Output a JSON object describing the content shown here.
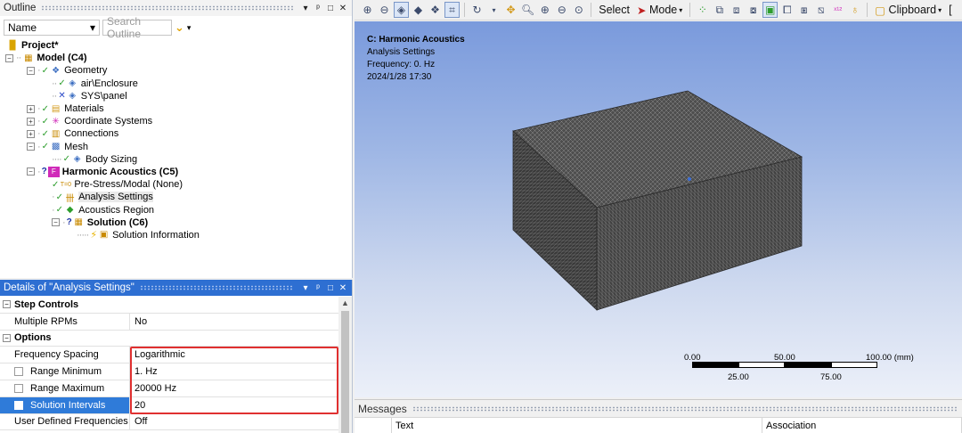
{
  "outline": {
    "title": "Outline",
    "controls": [
      "▾",
      "ᵖ",
      "□",
      "✕"
    ],
    "filter_label": "Name",
    "search_placeholder": "Search Outline",
    "tree": [
      {
        "label": "Project*",
        "bold": true
      },
      {
        "label": "Model (C4)",
        "bold": true
      },
      {
        "label": "Geometry"
      },
      {
        "label": "air\\Enclosure"
      },
      {
        "label": "SYS\\panel"
      },
      {
        "label": "Materials"
      },
      {
        "label": "Coordinate Systems"
      },
      {
        "label": "Connections"
      },
      {
        "label": "Mesh"
      },
      {
        "label": "Body Sizing"
      },
      {
        "label": "Harmonic Acoustics (C5)",
        "bold": true
      },
      {
        "label": "Pre-Stress/Modal (None)"
      },
      {
        "label": "Analysis Settings"
      },
      {
        "label": "Acoustics Region"
      },
      {
        "label": "Solution (C6)",
        "bold": true
      },
      {
        "label": "Solution Information"
      }
    ]
  },
  "details": {
    "title": "Details of \"Analysis Settings\"",
    "groups": [
      {
        "label": "Step Controls"
      },
      {
        "label": "Options"
      }
    ],
    "rows": [
      {
        "key": "Multiple RPMs",
        "value": "No"
      },
      {
        "key": "Frequency Spacing",
        "value": "Logarithmic"
      },
      {
        "key": "Range Minimum",
        "value": "1. Hz"
      },
      {
        "key": "Range Maximum",
        "value": "20000 Hz"
      },
      {
        "key": "Solution Intervals",
        "value": "20"
      },
      {
        "key": "User Defined Frequencies",
        "value": "Off"
      }
    ]
  },
  "toolbar": {
    "select_label": "Select",
    "mode_label": "Mode",
    "clipboard_label": "Clipboard",
    "extra": "["
  },
  "viewport": {
    "title": "C: Harmonic Acoustics",
    "line1": "Analysis Settings",
    "line2": "Frequency: 0. Hz",
    "line3": "2024/1/28 17:30",
    "scale": {
      "top_labels": [
        "0.00",
        "50.00",
        "100.00 (mm)"
      ],
      "bottom_labels": [
        "25.00",
        "75.00"
      ]
    }
  },
  "messages": {
    "title": "Messages",
    "columns": [
      "Text",
      "Association"
    ]
  }
}
